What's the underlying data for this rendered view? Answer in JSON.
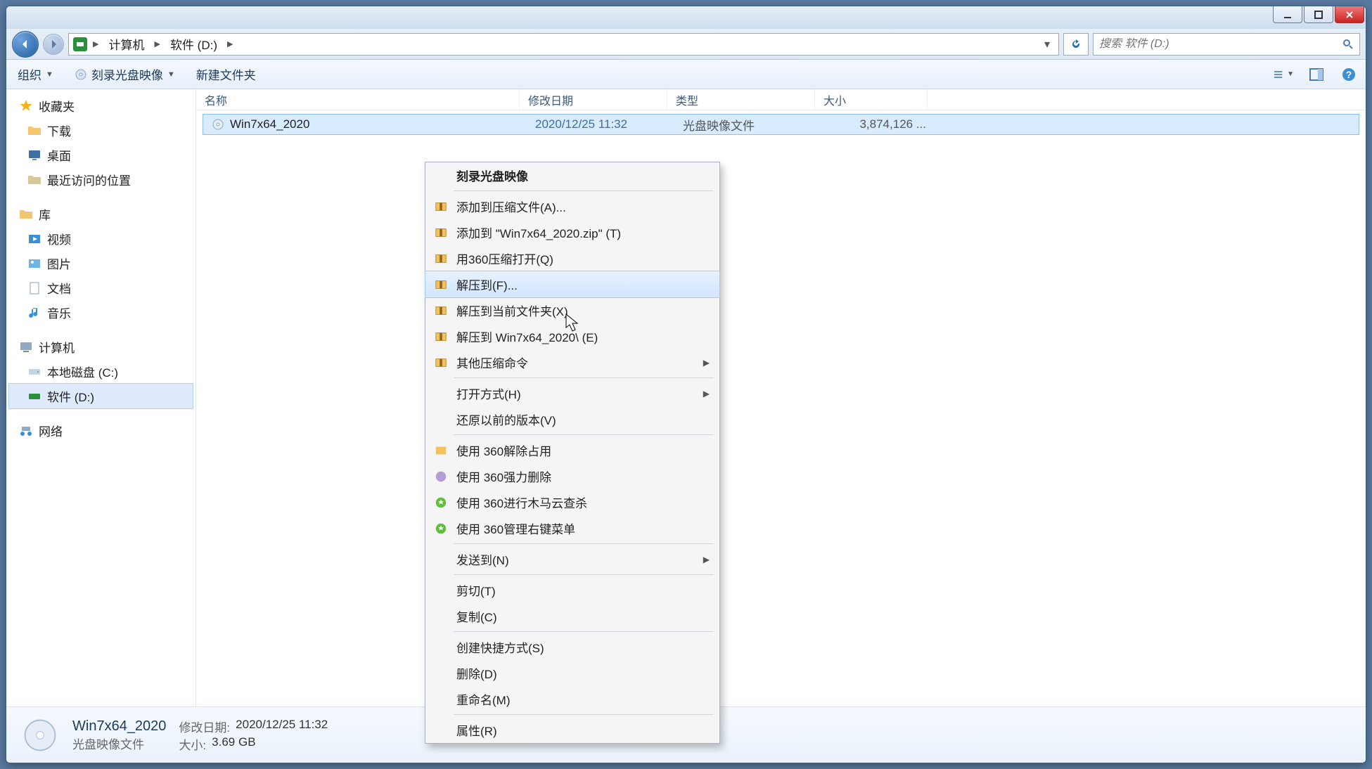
{
  "breadcrumb": {
    "segments": [
      "计算机",
      "软件 (D:)"
    ]
  },
  "searchbox": {
    "placeholder": "搜索 软件 (D:)"
  },
  "toolbar": {
    "organize": "组织",
    "burn": "刻录光盘映像",
    "newfolder": "新建文件夹"
  },
  "columns": {
    "name": "名称",
    "date": "修改日期",
    "type": "类型",
    "size": "大小"
  },
  "sidebar": {
    "favorites": {
      "head": "收藏夹",
      "items": [
        "下载",
        "桌面",
        "最近访问的位置"
      ]
    },
    "libraries": {
      "head": "库",
      "items": [
        "视频",
        "图片",
        "文档",
        "音乐"
      ]
    },
    "computer": {
      "head": "计算机",
      "items": [
        "本地磁盘 (C:)",
        "软件 (D:)"
      ]
    },
    "network": {
      "head": "网络"
    }
  },
  "files": [
    {
      "name": "Win7x64_2020",
      "date": "2020/12/25 11:32",
      "type": "光盘映像文件",
      "size": "3,874,126 ..."
    }
  ],
  "context_menu": {
    "items": [
      {
        "label": "刻录光盘映像",
        "bold": true
      },
      {
        "sep": true
      },
      {
        "label": "添加到压缩文件(A)...",
        "icon": "zip"
      },
      {
        "label": "添加到 \"Win7x64_2020.zip\" (T)",
        "icon": "zip"
      },
      {
        "label": "用360压缩打开(Q)",
        "icon": "zip"
      },
      {
        "label": "解压到(F)...",
        "icon": "zip",
        "hover": true
      },
      {
        "label": "解压到当前文件夹(X)",
        "icon": "zip"
      },
      {
        "label": "解压到 Win7x64_2020\\ (E)",
        "icon": "zip"
      },
      {
        "label": "其他压缩命令",
        "icon": "zip",
        "submenu": true
      },
      {
        "sep": true
      },
      {
        "label": "打开方式(H)",
        "submenu": true
      },
      {
        "label": "还原以前的版本(V)"
      },
      {
        "sep": true
      },
      {
        "label": "使用 360解除占用",
        "icon": "360y"
      },
      {
        "label": "使用 360强力删除",
        "icon": "360p"
      },
      {
        "label": "使用 360进行木马云查杀",
        "icon": "360g"
      },
      {
        "label": "使用 360管理右键菜单",
        "icon": "360g"
      },
      {
        "sep": true
      },
      {
        "label": "发送到(N)",
        "submenu": true
      },
      {
        "sep": true
      },
      {
        "label": "剪切(T)"
      },
      {
        "label": "复制(C)"
      },
      {
        "sep": true
      },
      {
        "label": "创建快捷方式(S)"
      },
      {
        "label": "删除(D)"
      },
      {
        "label": "重命名(M)"
      },
      {
        "sep": true
      },
      {
        "label": "属性(R)"
      }
    ]
  },
  "details": {
    "title": "Win7x64_2020",
    "subtitle": "光盘映像文件",
    "date_k": "修改日期:",
    "date_v": "2020/12/25 11:32",
    "size_k": "大小:",
    "size_v": "3.69 GB"
  }
}
